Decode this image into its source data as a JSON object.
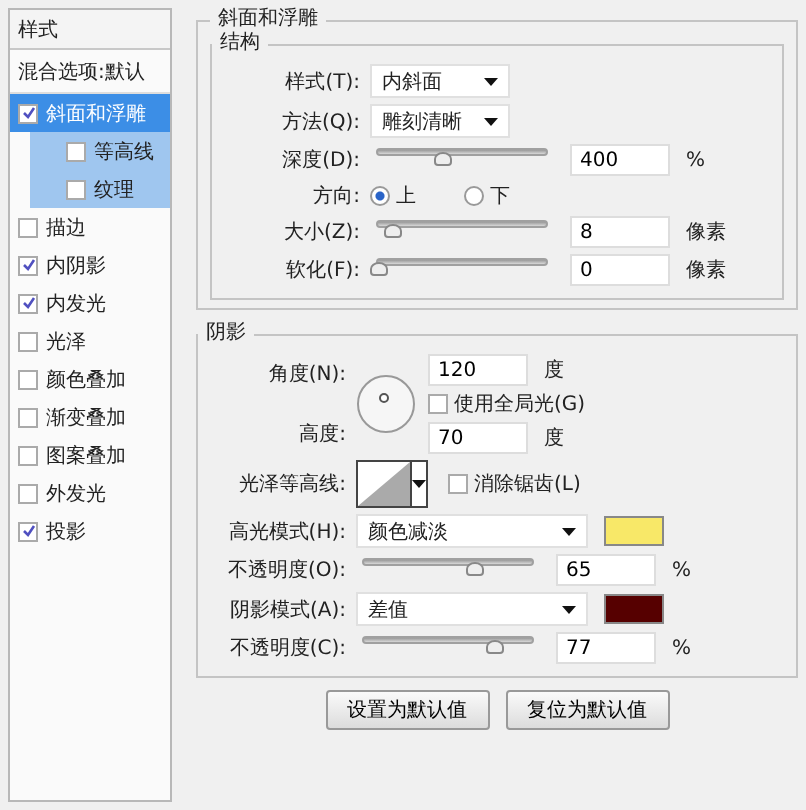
{
  "sidebar": {
    "header": "样式",
    "blend_options": "混合选项:默认",
    "items": [
      {
        "label": "斜面和浮雕",
        "kind": "main",
        "checked": true,
        "selected": true
      },
      {
        "label": "等高线",
        "kind": "sub",
        "checked": false,
        "selected": false
      },
      {
        "label": "纹理",
        "kind": "sub",
        "checked": false,
        "selected": false
      },
      {
        "label": "描边",
        "kind": "main",
        "checked": false,
        "selected": false
      },
      {
        "label": "内阴影",
        "kind": "main",
        "checked": true,
        "selected": false
      },
      {
        "label": "内发光",
        "kind": "main",
        "checked": true,
        "selected": false
      },
      {
        "label": "光泽",
        "kind": "main",
        "checked": false,
        "selected": false
      },
      {
        "label": "颜色叠加",
        "kind": "main",
        "checked": false,
        "selected": false
      },
      {
        "label": "渐变叠加",
        "kind": "main",
        "checked": false,
        "selected": false
      },
      {
        "label": "图案叠加",
        "kind": "main",
        "checked": false,
        "selected": false
      },
      {
        "label": "外发光",
        "kind": "main",
        "checked": false,
        "selected": false
      },
      {
        "label": "投影",
        "kind": "main",
        "checked": true,
        "selected": false
      }
    ]
  },
  "panel_title": "斜面和浮雕",
  "structure": {
    "title": "结构",
    "rows": [
      {
        "kind": "select",
        "label": "样式(T):",
        "value": "内斜面"
      },
      {
        "kind": "select",
        "label": "方法(Q):",
        "value": "雕刻清晰"
      },
      {
        "kind": "slider",
        "label": "深度(D):",
        "level": 0.38,
        "value": "400",
        "unit": "%"
      },
      {
        "kind": "radio",
        "label": "方向:",
        "options": [
          {
            "label": "上",
            "selected": true
          },
          {
            "label": "下",
            "selected": false
          }
        ]
      },
      {
        "kind": "slider",
        "label": "大小(Z):",
        "level": 0.08,
        "value": "8",
        "unit": "像素"
      },
      {
        "kind": "slider",
        "label": "软化(F):",
        "level": 0,
        "value": "0",
        "unit": "像素"
      }
    ]
  },
  "shading": {
    "title": "阴影",
    "angle": {
      "label": "角度(N):",
      "value": "120",
      "unit": "度"
    },
    "global_light": {
      "label": "使用全局光(G)",
      "checked": false
    },
    "altitude": {
      "label": "高度:",
      "value": "70",
      "unit": "度"
    },
    "gloss_contour": {
      "label": "光泽等高线:"
    },
    "anti_alias": {
      "label": "消除锯齿(L)",
      "checked": false
    },
    "rows": [
      {
        "kind": "mode",
        "label": "高光模式(H):",
        "value": "颜色减淡",
        "color": "#f8e868"
      },
      {
        "kind": "slider",
        "label": "不透明度(O):",
        "level": 0.65,
        "value": "65",
        "unit": "%"
      },
      {
        "kind": "mode",
        "label": "阴影模式(A):",
        "value": "差值",
        "color": "#560000"
      },
      {
        "kind": "slider",
        "label": "不透明度(C):",
        "level": 0.77,
        "value": "77",
        "unit": "%"
      }
    ]
  },
  "buttons": [
    "设置为默认值",
    "复位为默认值"
  ]
}
